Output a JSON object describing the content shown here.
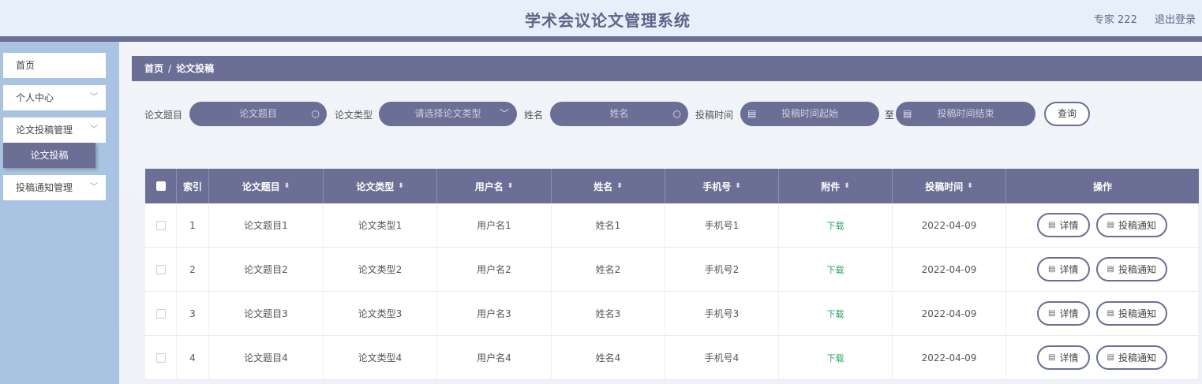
{
  "header": {
    "title": "学术会议论文管理系统",
    "user": "专家 222",
    "logout": "退出登录"
  },
  "sidebar": {
    "items": [
      {
        "label": "首页"
      },
      {
        "label": "个人中心"
      },
      {
        "label": "论文投稿管理"
      },
      {
        "label": "投稿通知管理"
      }
    ],
    "sub_item": "论文投稿"
  },
  "breadcrumb": {
    "home": "首页",
    "separator": "/",
    "current": "论文投稿"
  },
  "filters": {
    "title_label": "论文题目",
    "title_placeholder": "论文题目",
    "type_label": "论文类型",
    "type_placeholder": "请选择论文类型",
    "name_label": "姓名",
    "name_placeholder": "姓名",
    "time_label": "投稿时间",
    "time_start_placeholder": "投稿时间起始",
    "time_to": "至",
    "time_end_placeholder": "投稿时间结束",
    "query": "查询"
  },
  "table": {
    "headers": {
      "index": "索引",
      "title": "论文题目",
      "type": "论文类型",
      "username": "用户名",
      "name": "姓名",
      "phone": "手机号",
      "attachment": "附件",
      "time": "投稿时间",
      "ops": "操作"
    },
    "rows": [
      {
        "index": "1",
        "title": "论文题目1",
        "type": "论文类型1",
        "username": "用户名1",
        "name": "姓名1",
        "phone": "手机号1",
        "attachment": "下载",
        "time": "2022-04-09"
      },
      {
        "index": "2",
        "title": "论文题目2",
        "type": "论文类型2",
        "username": "用户名2",
        "name": "姓名2",
        "phone": "手机号2",
        "attachment": "下载",
        "time": "2022-04-09"
      },
      {
        "index": "3",
        "title": "论文题目3",
        "type": "论文类型3",
        "username": "用户名3",
        "name": "姓名3",
        "phone": "手机号3",
        "attachment": "下载",
        "time": "2022-04-09"
      },
      {
        "index": "4",
        "title": "论文题目4",
        "type": "论文类型4",
        "username": "用户名4",
        "name": "姓名4",
        "phone": "手机号4",
        "attachment": "下载",
        "time": "2022-04-09"
      }
    ],
    "btn_detail": "详情",
    "btn_notify": "投稿通知"
  },
  "colors": {
    "accent": "#6b6f95",
    "sidebar": "#a9c4e2",
    "header_bg": "#e6f0fa",
    "download": "#2aa55e"
  }
}
